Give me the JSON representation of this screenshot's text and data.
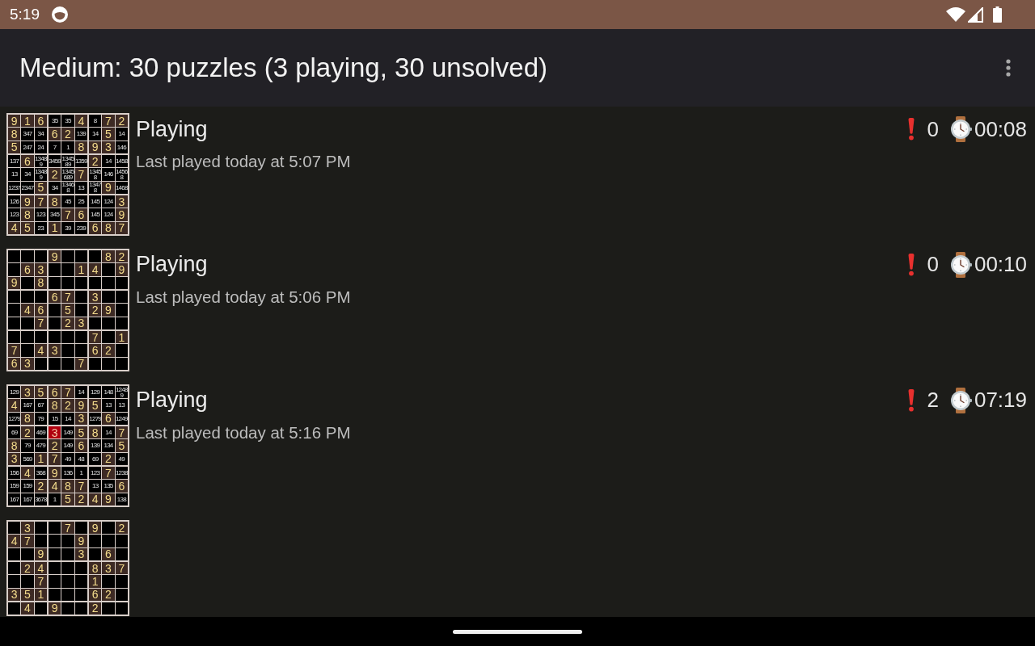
{
  "status_bar": {
    "time": "5:19"
  },
  "app_bar": {
    "title": "Medium: 30 puzzles (3 playing, 30 unsolved)"
  },
  "puzzles": [
    {
      "status": "Playing",
      "last_played": "Last played today at 5:07 PM",
      "mistakes": "0",
      "time": "00:08",
      "grid": [
        [
          {
            "kind": "digit",
            "text": "9"
          },
          {
            "kind": "digit",
            "text": "1"
          },
          {
            "kind": "digit",
            "text": "6"
          },
          {
            "kind": "notes",
            "text": "35"
          },
          {
            "kind": "notes",
            "text": "35"
          },
          {
            "kind": "digit",
            "text": "4"
          },
          {
            "kind": "notes",
            "text": "8"
          },
          {
            "kind": "digit",
            "text": "7"
          },
          {
            "kind": "digit",
            "text": "2"
          }
        ],
        [
          {
            "kind": "digit",
            "text": "8"
          },
          {
            "kind": "notes",
            "text": "347"
          },
          {
            "kind": "notes",
            "text": "34"
          },
          {
            "kind": "digit",
            "text": "6"
          },
          {
            "kind": "digit",
            "text": "2"
          },
          {
            "kind": "notes",
            "text": "139"
          },
          {
            "kind": "notes",
            "text": "14"
          },
          {
            "kind": "digit",
            "text": "5"
          },
          {
            "kind": "notes",
            "text": "14"
          }
        ],
        [
          {
            "kind": "digit",
            "text": "5"
          },
          {
            "kind": "notes",
            "text": "247"
          },
          {
            "kind": "notes",
            "text": "24"
          },
          {
            "kind": "notes",
            "text": "7"
          },
          {
            "kind": "notes",
            "text": "1"
          },
          {
            "kind": "digit",
            "text": "8"
          },
          {
            "kind": "digit",
            "text": "9"
          },
          {
            "kind": "digit",
            "text": "3"
          },
          {
            "kind": "notes",
            "text": "146"
          }
        ],
        [
          {
            "kind": "notes",
            "text": "137"
          },
          {
            "kind": "digit",
            "text": "6"
          },
          {
            "kind": "notes",
            "text": "13489"
          },
          {
            "kind": "notes",
            "text": "3459"
          },
          {
            "kind": "notes",
            "text": "134589"
          },
          {
            "kind": "notes",
            "text": "1359"
          },
          {
            "kind": "digit",
            "text": "2"
          },
          {
            "kind": "notes",
            "text": "14"
          },
          {
            "kind": "notes",
            "text": "1458"
          }
        ],
        [
          {
            "kind": "notes",
            "text": "13"
          },
          {
            "kind": "notes",
            "text": "34"
          },
          {
            "kind": "notes",
            "text": "13489"
          },
          {
            "kind": "digit",
            "text": "2"
          },
          {
            "kind": "notes",
            "text": "1345689"
          },
          {
            "kind": "digit",
            "text": "7"
          },
          {
            "kind": "notes",
            "text": "13458"
          },
          {
            "kind": "notes",
            "text": "146"
          },
          {
            "kind": "notes",
            "text": "14568"
          }
        ],
        [
          {
            "kind": "notes",
            "text": "1237"
          },
          {
            "kind": "notes",
            "text": "2347"
          },
          {
            "kind": "digit",
            "text": "5"
          },
          {
            "kind": "notes",
            "text": "34"
          },
          {
            "kind": "notes",
            "text": "13468"
          },
          {
            "kind": "notes",
            "text": "13"
          },
          {
            "kind": "notes",
            "text": "13478"
          },
          {
            "kind": "digit",
            "text": "9"
          },
          {
            "kind": "notes",
            "text": "1468"
          }
        ],
        [
          {
            "kind": "notes",
            "text": "126"
          },
          {
            "kind": "digit",
            "text": "9"
          },
          {
            "kind": "digit",
            "text": "7"
          },
          {
            "kind": "digit",
            "text": "8"
          },
          {
            "kind": "notes",
            "text": "45"
          },
          {
            "kind": "notes",
            "text": "25"
          },
          {
            "kind": "notes",
            "text": "145"
          },
          {
            "kind": "notes",
            "text": "124"
          },
          {
            "kind": "digit",
            "text": "3"
          }
        ],
        [
          {
            "kind": "notes",
            "text": "123"
          },
          {
            "kind": "digit",
            "text": "8"
          },
          {
            "kind": "notes",
            "text": "123"
          },
          {
            "kind": "notes",
            "text": "345"
          },
          {
            "kind": "digit",
            "text": "7"
          },
          {
            "kind": "digit",
            "text": "6"
          },
          {
            "kind": "notes",
            "text": "145"
          },
          {
            "kind": "notes",
            "text": "124"
          },
          {
            "kind": "digit",
            "text": "9"
          }
        ],
        [
          {
            "kind": "digit",
            "text": "4"
          },
          {
            "kind": "digit",
            "text": "5"
          },
          {
            "kind": "notes",
            "text": "23"
          },
          {
            "kind": "digit",
            "text": "1"
          },
          {
            "kind": "notes",
            "text": "39"
          },
          {
            "kind": "notes",
            "text": "239"
          },
          {
            "kind": "digit",
            "text": "6"
          },
          {
            "kind": "digit",
            "text": "8"
          },
          {
            "kind": "digit",
            "text": "7"
          }
        ]
      ]
    },
    {
      "status": "Playing",
      "last_played": "Last played today at 5:06 PM",
      "mistakes": "0",
      "time": "00:10",
      "grid": [
        [
          {
            "kind": "empty"
          },
          {
            "kind": "empty"
          },
          {
            "kind": "empty"
          },
          {
            "kind": "digit",
            "text": "9"
          },
          {
            "kind": "empty"
          },
          {
            "kind": "empty"
          },
          {
            "kind": "empty"
          },
          {
            "kind": "digit",
            "text": "8"
          },
          {
            "kind": "digit",
            "text": "2"
          }
        ],
        [
          {
            "kind": "empty"
          },
          {
            "kind": "digit",
            "text": "6"
          },
          {
            "kind": "digit",
            "text": "3"
          },
          {
            "kind": "empty"
          },
          {
            "kind": "empty"
          },
          {
            "kind": "digit",
            "text": "1"
          },
          {
            "kind": "digit",
            "text": "4"
          },
          {
            "kind": "empty"
          },
          {
            "kind": "digit",
            "text": "9"
          }
        ],
        [
          {
            "kind": "digit",
            "text": "9"
          },
          {
            "kind": "empty"
          },
          {
            "kind": "digit",
            "text": "8"
          },
          {
            "kind": "empty"
          },
          {
            "kind": "empty"
          },
          {
            "kind": "empty"
          },
          {
            "kind": "empty"
          },
          {
            "kind": "empty"
          },
          {
            "kind": "empty"
          }
        ],
        [
          {
            "kind": "empty"
          },
          {
            "kind": "empty"
          },
          {
            "kind": "empty"
          },
          {
            "kind": "digit",
            "text": "6"
          },
          {
            "kind": "digit",
            "text": "7"
          },
          {
            "kind": "empty"
          },
          {
            "kind": "digit",
            "text": "3"
          },
          {
            "kind": "empty"
          },
          {
            "kind": "empty"
          }
        ],
        [
          {
            "kind": "empty"
          },
          {
            "kind": "digit",
            "text": "4"
          },
          {
            "kind": "digit",
            "text": "6"
          },
          {
            "kind": "empty"
          },
          {
            "kind": "digit",
            "text": "5"
          },
          {
            "kind": "empty"
          },
          {
            "kind": "digit",
            "text": "2"
          },
          {
            "kind": "digit",
            "text": "9"
          },
          {
            "kind": "empty"
          }
        ],
        [
          {
            "kind": "empty"
          },
          {
            "kind": "empty"
          },
          {
            "kind": "digit",
            "text": "7"
          },
          {
            "kind": "empty"
          },
          {
            "kind": "digit",
            "text": "2"
          },
          {
            "kind": "digit",
            "text": "3"
          },
          {
            "kind": "empty"
          },
          {
            "kind": "empty"
          },
          {
            "kind": "empty"
          }
        ],
        [
          {
            "kind": "empty"
          },
          {
            "kind": "empty"
          },
          {
            "kind": "empty"
          },
          {
            "kind": "empty"
          },
          {
            "kind": "empty"
          },
          {
            "kind": "empty"
          },
          {
            "kind": "digit",
            "text": "7"
          },
          {
            "kind": "empty"
          },
          {
            "kind": "digit",
            "text": "1"
          }
        ],
        [
          {
            "kind": "digit",
            "text": "7"
          },
          {
            "kind": "empty"
          },
          {
            "kind": "digit",
            "text": "4"
          },
          {
            "kind": "digit",
            "text": "3"
          },
          {
            "kind": "empty"
          },
          {
            "kind": "empty"
          },
          {
            "kind": "digit",
            "text": "6"
          },
          {
            "kind": "digit",
            "text": "2"
          },
          {
            "kind": "empty"
          }
        ],
        [
          {
            "kind": "digit",
            "text": "6"
          },
          {
            "kind": "digit",
            "text": "3"
          },
          {
            "kind": "empty"
          },
          {
            "kind": "empty"
          },
          {
            "kind": "empty"
          },
          {
            "kind": "digit",
            "text": "7"
          },
          {
            "kind": "empty"
          },
          {
            "kind": "empty"
          },
          {
            "kind": "empty"
          }
        ]
      ]
    },
    {
      "status": "Playing",
      "last_played": "Last played today at 5:16 PM",
      "mistakes": "2",
      "time": "07:19",
      "grid": [
        [
          {
            "kind": "notes",
            "text": "129"
          },
          {
            "kind": "digit",
            "text": "3"
          },
          {
            "kind": "digit",
            "text": "5"
          },
          {
            "kind": "digit",
            "text": "6"
          },
          {
            "kind": "digit",
            "text": "7"
          },
          {
            "kind": "notes",
            "text": "14"
          },
          {
            "kind": "notes",
            "text": "129"
          },
          {
            "kind": "notes",
            "text": "148"
          },
          {
            "kind": "notes",
            "text": "12489"
          }
        ],
        [
          {
            "kind": "digit",
            "text": "4"
          },
          {
            "kind": "notes",
            "text": "167"
          },
          {
            "kind": "notes",
            "text": "67"
          },
          {
            "kind": "digit",
            "text": "8"
          },
          {
            "kind": "digit",
            "text": "2"
          },
          {
            "kind": "digit",
            "text": "9"
          },
          {
            "kind": "digit",
            "text": "5"
          },
          {
            "kind": "notes",
            "text": "13"
          },
          {
            "kind": "notes",
            "text": "13"
          }
        ],
        [
          {
            "kind": "notes",
            "text": "1279"
          },
          {
            "kind": "digit",
            "text": "8"
          },
          {
            "kind": "notes",
            "text": "79"
          },
          {
            "kind": "notes",
            "text": "15"
          },
          {
            "kind": "notes",
            "text": "14"
          },
          {
            "kind": "digit",
            "text": "3"
          },
          {
            "kind": "notes",
            "text": "1279"
          },
          {
            "kind": "digit",
            "text": "6"
          },
          {
            "kind": "notes",
            "text": "1249"
          }
        ],
        [
          {
            "kind": "notes",
            "text": "69"
          },
          {
            "kind": "digit",
            "text": "2"
          },
          {
            "kind": "notes",
            "text": "469"
          },
          {
            "kind": "error",
            "text": "3"
          },
          {
            "kind": "notes",
            "text": "149"
          },
          {
            "kind": "digit",
            "text": "5"
          },
          {
            "kind": "digit",
            "text": "8"
          },
          {
            "kind": "notes",
            "text": "14"
          },
          {
            "kind": "digit",
            "text": "7"
          }
        ],
        [
          {
            "kind": "digit",
            "text": "8"
          },
          {
            "kind": "notes",
            "text": "79"
          },
          {
            "kind": "notes",
            "text": "479"
          },
          {
            "kind": "digit",
            "text": "2"
          },
          {
            "kind": "notes",
            "text": "149"
          },
          {
            "kind": "digit",
            "text": "6"
          },
          {
            "kind": "notes",
            "text": "139"
          },
          {
            "kind": "notes",
            "text": "134"
          },
          {
            "kind": "digit",
            "text": "5"
          }
        ],
        [
          {
            "kind": "digit",
            "text": "3"
          },
          {
            "kind": "notes",
            "text": "569"
          },
          {
            "kind": "digit",
            "text": "1"
          },
          {
            "kind": "digit",
            "text": "7"
          },
          {
            "kind": "notes",
            "text": "49"
          },
          {
            "kind": "notes",
            "text": "48"
          },
          {
            "kind": "notes",
            "text": "69"
          },
          {
            "kind": "digit",
            "text": "2"
          },
          {
            "kind": "notes",
            "text": "49"
          }
        ],
        [
          {
            "kind": "notes",
            "text": "156"
          },
          {
            "kind": "digit",
            "text": "4"
          },
          {
            "kind": "notes",
            "text": "368"
          },
          {
            "kind": "digit",
            "text": "9"
          },
          {
            "kind": "notes",
            "text": "136"
          },
          {
            "kind": "notes",
            "text": "1"
          },
          {
            "kind": "notes",
            "text": "123"
          },
          {
            "kind": "digit",
            "text": "7"
          },
          {
            "kind": "notes",
            "text": "1238"
          }
        ],
        [
          {
            "kind": "notes",
            "text": "159"
          },
          {
            "kind": "notes",
            "text": "159"
          },
          {
            "kind": "digit",
            "text": "2"
          },
          {
            "kind": "digit",
            "text": "4"
          },
          {
            "kind": "digit",
            "text": "8"
          },
          {
            "kind": "digit",
            "text": "7"
          },
          {
            "kind": "notes",
            "text": "13"
          },
          {
            "kind": "notes",
            "text": "135"
          },
          {
            "kind": "digit",
            "text": "6"
          }
        ],
        [
          {
            "kind": "notes",
            "text": "167"
          },
          {
            "kind": "notes",
            "text": "167"
          },
          {
            "kind": "notes",
            "text": "3678"
          },
          {
            "kind": "notes",
            "text": "1"
          },
          {
            "kind": "digit",
            "text": "5"
          },
          {
            "kind": "digit",
            "text": "2"
          },
          {
            "kind": "digit",
            "text": "4"
          },
          {
            "kind": "digit",
            "text": "9"
          },
          {
            "kind": "notes",
            "text": "138"
          }
        ]
      ]
    },
    {
      "grid": [
        [
          {
            "kind": "empty"
          },
          {
            "kind": "digit",
            "text": "3"
          },
          {
            "kind": "empty"
          },
          {
            "kind": "empty"
          },
          {
            "kind": "digit",
            "text": "7"
          },
          {
            "kind": "empty"
          },
          {
            "kind": "digit",
            "text": "9"
          },
          {
            "kind": "empty"
          },
          {
            "kind": "digit",
            "text": "2"
          }
        ],
        [
          {
            "kind": "digit",
            "text": "4"
          },
          {
            "kind": "digit",
            "text": "7"
          },
          {
            "kind": "empty"
          },
          {
            "kind": "empty"
          },
          {
            "kind": "empty"
          },
          {
            "kind": "digit",
            "text": "9"
          },
          {
            "kind": "empty"
          },
          {
            "kind": "empty"
          },
          {
            "kind": "empty"
          }
        ],
        [
          {
            "kind": "empty"
          },
          {
            "kind": "empty"
          },
          {
            "kind": "digit",
            "text": "9"
          },
          {
            "kind": "empty"
          },
          {
            "kind": "empty"
          },
          {
            "kind": "digit",
            "text": "3"
          },
          {
            "kind": "empty"
          },
          {
            "kind": "digit",
            "text": "6"
          },
          {
            "kind": "empty"
          }
        ],
        [
          {
            "kind": "empty"
          },
          {
            "kind": "digit",
            "text": "2"
          },
          {
            "kind": "digit",
            "text": "4"
          },
          {
            "kind": "empty"
          },
          {
            "kind": "empty"
          },
          {
            "kind": "empty"
          },
          {
            "kind": "digit",
            "text": "8"
          },
          {
            "kind": "digit",
            "text": "3"
          },
          {
            "kind": "digit",
            "text": "7"
          }
        ],
        [
          {
            "kind": "empty"
          },
          {
            "kind": "empty"
          },
          {
            "kind": "digit",
            "text": "7"
          },
          {
            "kind": "empty"
          },
          {
            "kind": "empty"
          },
          {
            "kind": "empty"
          },
          {
            "kind": "digit",
            "text": "1"
          },
          {
            "kind": "empty"
          },
          {
            "kind": "empty"
          }
        ],
        [
          {
            "kind": "digit",
            "text": "3"
          },
          {
            "kind": "digit",
            "text": "5"
          },
          {
            "kind": "digit",
            "text": "1"
          },
          {
            "kind": "empty"
          },
          {
            "kind": "empty"
          },
          {
            "kind": "empty"
          },
          {
            "kind": "digit",
            "text": "6"
          },
          {
            "kind": "digit",
            "text": "2"
          },
          {
            "kind": "empty"
          }
        ],
        [
          {
            "kind": "empty"
          },
          {
            "kind": "digit",
            "text": "4"
          },
          {
            "kind": "empty"
          },
          {
            "kind": "digit",
            "text": "9"
          },
          {
            "kind": "empty"
          },
          {
            "kind": "empty"
          },
          {
            "kind": "digit",
            "text": "2"
          },
          {
            "kind": "empty"
          },
          {
            "kind": "empty"
          }
        ]
      ]
    }
  ]
}
